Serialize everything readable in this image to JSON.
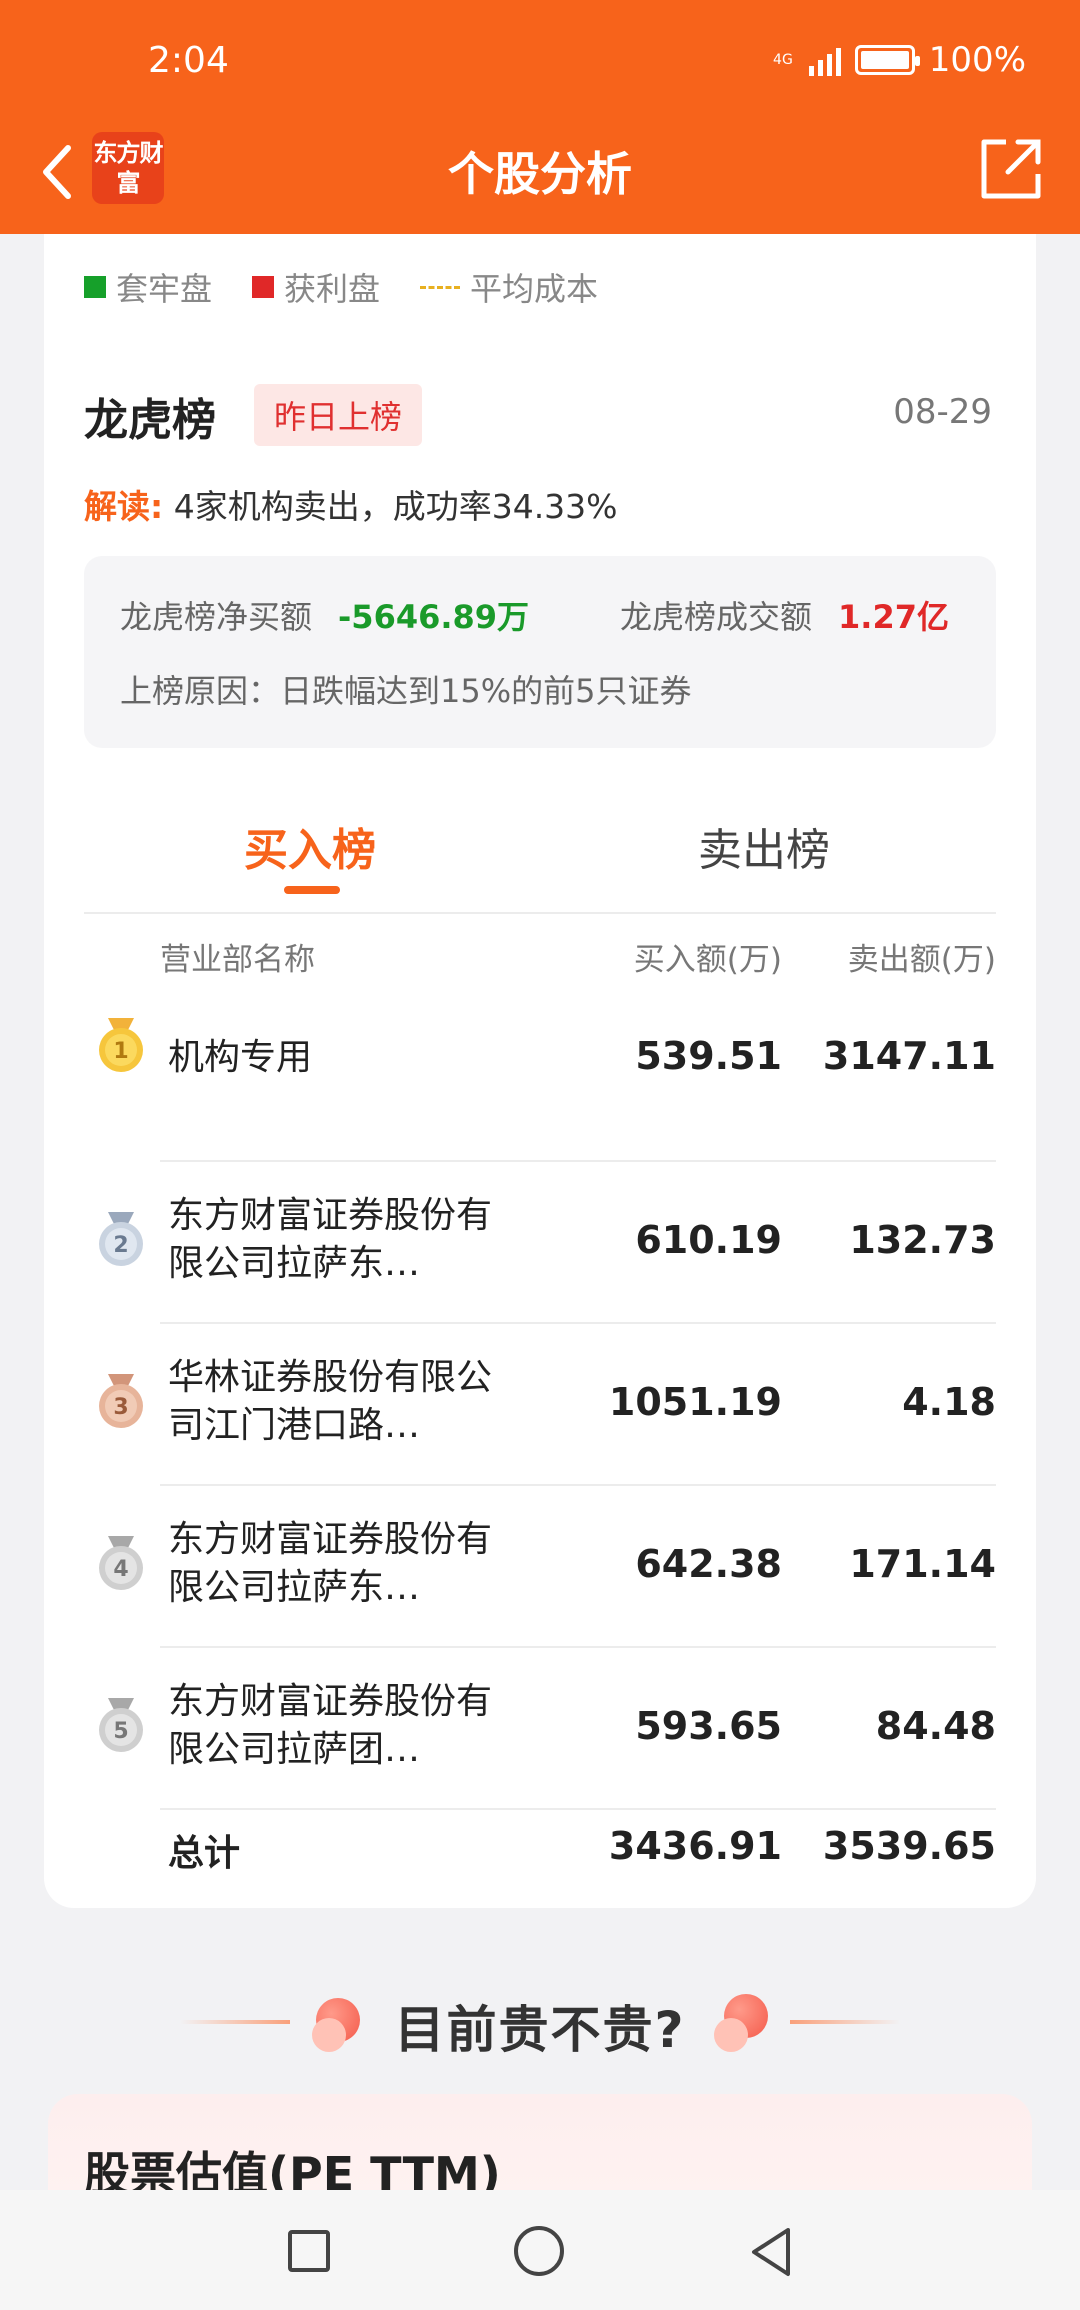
{
  "status": {
    "time": "2:04",
    "network": "4G",
    "battery": "100%"
  },
  "header": {
    "title": "个股分析",
    "logo_text": "东方财富"
  },
  "legend": [
    {
      "label": "套牢盘",
      "color": "#16a02a"
    },
    {
      "label": "获利盘",
      "color": "#e02828"
    },
    {
      "label": "平均成本",
      "color": "#e8b020"
    }
  ],
  "lhb": {
    "title": "龙虎榜",
    "tag": "昨日上榜",
    "date": "08-29",
    "interpret_label": "解读:",
    "interpret_text": "4家机构卖出，成功率34.33%",
    "net_buy_label": "龙虎榜净买额",
    "net_buy_value": "-5646.89万",
    "turnover_label": "龙虎榜成交额",
    "turnover_value": "1.27亿",
    "reason": "上榜原因：日跌幅达到15%的前5只证券"
  },
  "tabs": {
    "buy": "买入榜",
    "sell": "卖出榜"
  },
  "table": {
    "headers": {
      "name": "营业部名称",
      "buy": "买入额(万)",
      "sell": "卖出额(万)"
    },
    "rows": [
      {
        "rank": "1",
        "name": "机构专用",
        "buy": "539.51",
        "sell": "3147.11"
      },
      {
        "rank": "2",
        "name": "东方财富证券股份有限公司拉萨东…",
        "buy": "610.19",
        "sell": "132.73"
      },
      {
        "rank": "3",
        "name": "华林证券股份有限公司江门港口路…",
        "buy": "1051.19",
        "sell": "4.18"
      },
      {
        "rank": "4",
        "name": "东方财富证券股份有限公司拉萨东…",
        "buy": "642.38",
        "sell": "171.14"
      },
      {
        "rank": "5",
        "name": "东方财富证券股份有限公司拉萨团…",
        "buy": "593.65",
        "sell": "84.48"
      }
    ],
    "total": {
      "label": "总计",
      "buy": "3436.91",
      "sell": "3539.65"
    }
  },
  "section": {
    "title": "目前贵不贵?"
  },
  "pe": {
    "title": "股票估值(PE TTM)"
  }
}
